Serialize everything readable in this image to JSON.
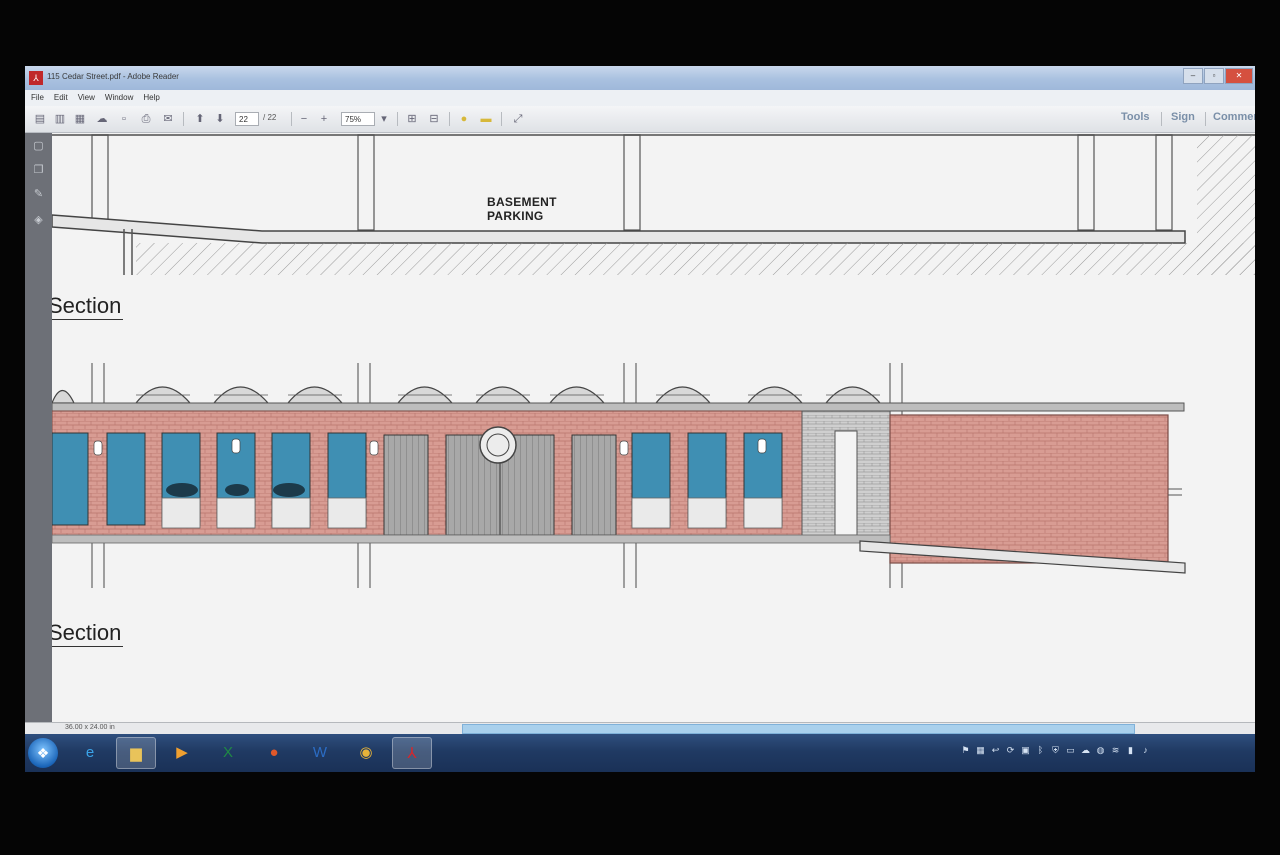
{
  "window": {
    "title": "115 Cedar Street.pdf - Adobe Reader",
    "controls": [
      "–",
      "▫",
      "✕"
    ]
  },
  "menu": [
    "File",
    "Edit",
    "View",
    "Window",
    "Help"
  ],
  "toolbar": {
    "page_current": "22",
    "page_total": "/ 22",
    "zoom": "75%",
    "right_buttons": [
      "Tools",
      "Sign",
      "Comment"
    ]
  },
  "document": {
    "label_basement_line1": "BASEMENT",
    "label_basement_line2": "PARKING",
    "heading_1": "Section",
    "heading_2": "Section"
  },
  "statusbar": {
    "page_size": "36.00 x 24.00 in"
  },
  "colors": {
    "brick": "#d59a92",
    "glass": "#3f8fb3",
    "taskbar": "#203a63",
    "titlebar": "#a9c1e0"
  },
  "taskbar": {
    "apps": [
      {
        "name": "internet-explorer",
        "glyph": "e",
        "color": "#3aa3e8"
      },
      {
        "name": "file-explorer",
        "glyph": "▆",
        "color": "#e9c35a"
      },
      {
        "name": "media-player",
        "glyph": "▶",
        "color": "#f0a030"
      },
      {
        "name": "excel",
        "glyph": "X",
        "color": "#1f8a44"
      },
      {
        "name": "powerpoint",
        "glyph": "●",
        "color": "#e0582a"
      },
      {
        "name": "word",
        "glyph": "W",
        "color": "#2b6cc4"
      },
      {
        "name": "chrome",
        "glyph": "◉",
        "color": "#e7b339"
      },
      {
        "name": "adobe-reader",
        "glyph": "⅄",
        "color": "#d8262b"
      }
    ]
  }
}
